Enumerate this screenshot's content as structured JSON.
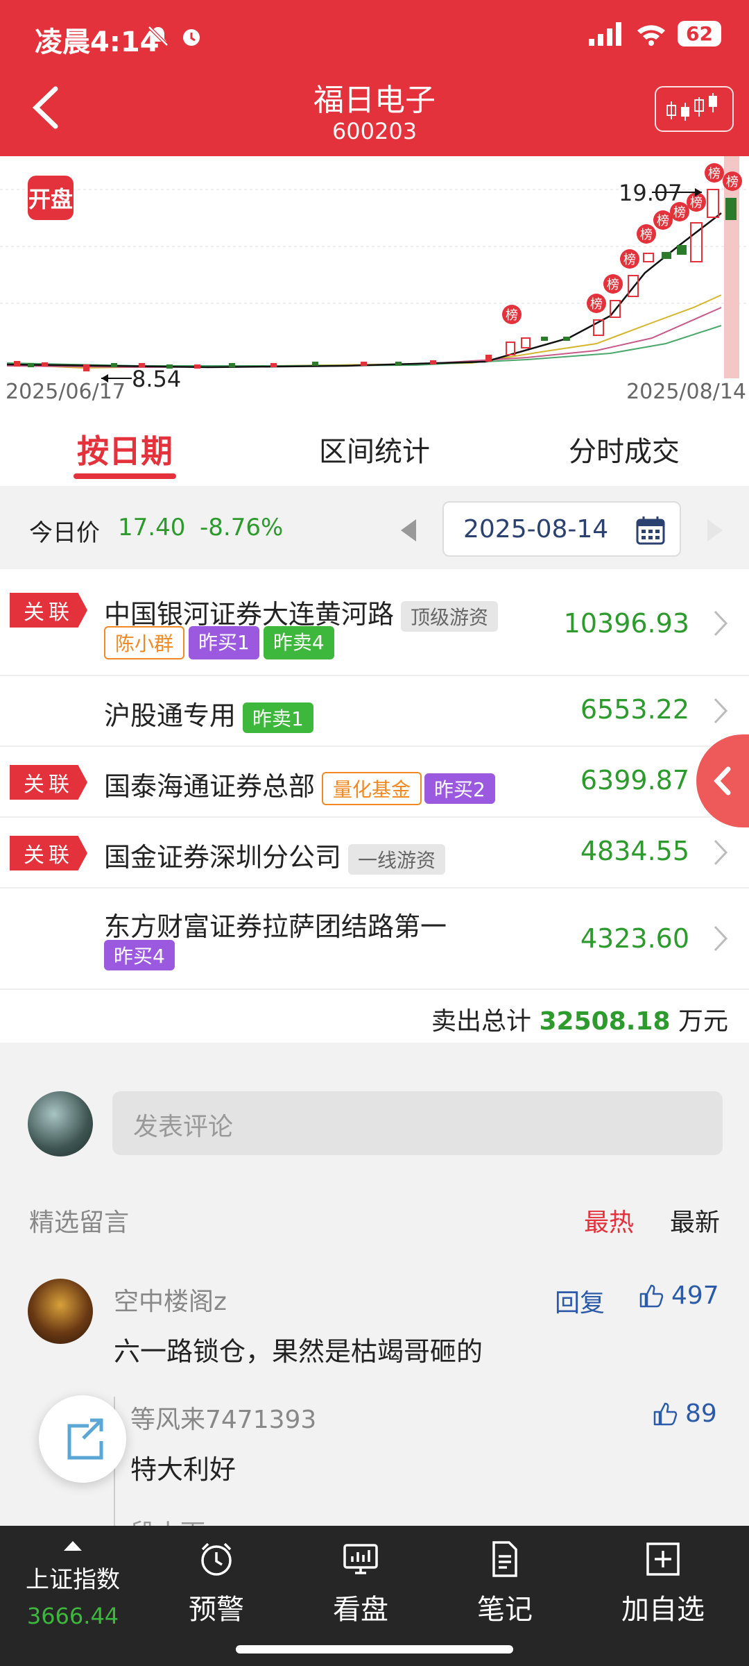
{
  "status_bar": {
    "time": "凌晨4:14",
    "battery": "62"
  },
  "header": {
    "title": "福日电子",
    "code": "600203"
  },
  "chart": {
    "badge": "开盘",
    "high_label": "19.07",
    "low_label": "8.54",
    "start_date": "2025/06/17",
    "end_date": "2025/08/14",
    "marker_text": "榜"
  },
  "tabs": [
    {
      "label": "按日期",
      "active": true
    },
    {
      "label": "区间统计",
      "active": false
    },
    {
      "label": "分时成交",
      "active": false
    }
  ],
  "price_bar": {
    "label": "今日价",
    "price": "17.40",
    "change": "-8.76%",
    "date": "2025-08-14"
  },
  "rows": [
    {
      "related": "关联",
      "name": "中国银河证券大连黄河路",
      "badge": "顶级游资",
      "sub": [
        "陈小群",
        "昨买1",
        "昨卖4"
      ],
      "amount": "10396.93"
    },
    {
      "related": "",
      "name": "沪股通专用",
      "badge": "昨卖1",
      "sub": [],
      "amount": "6553.22"
    },
    {
      "related": "关联",
      "name": "国泰海通证券总部",
      "badge": "量化基金",
      "badge2": "昨买2",
      "sub": [],
      "amount": "6399.87"
    },
    {
      "related": "关联",
      "name": "国金证券深圳分公司",
      "badge": "一线游资",
      "sub": [],
      "amount": "4834.55"
    },
    {
      "related": "",
      "name": "东方财富证券拉萨团结路第一",
      "badge": "",
      "sub": [
        "昨买4"
      ],
      "amount": "4323.60"
    }
  ],
  "total": {
    "label": "卖出总计",
    "value": "32508.18",
    "unit": "万元"
  },
  "comments": {
    "placeholder": "发表评论",
    "section_title": "精选留言",
    "sort_hot": "最热",
    "sort_new": "最新",
    "items": [
      {
        "user": "空中楼阁z",
        "reply_label": "回复",
        "likes": "497",
        "text": "六一路锁仓，果然是枯竭哥砸的"
      }
    ],
    "replies": [
      {
        "user": "等风来7471393",
        "likes": "89",
        "text": "特大利好"
      },
      {
        "user": "段小雨",
        "likes": ""
      }
    ]
  },
  "bottom_nav": {
    "index_label": "上证指数",
    "index_value": "3666.44",
    "items": [
      {
        "label": "预警",
        "icon": "alarm-clock-icon"
      },
      {
        "label": "看盘",
        "icon": "monitor-chart-icon"
      },
      {
        "label": "笔记",
        "icon": "note-icon"
      },
      {
        "label": "加自选",
        "icon": "add-square-icon"
      }
    ]
  },
  "colors": {
    "brand_red": "#e3323b",
    "gain_green": "#2c9a2c",
    "link_blue": "#2b5aa8"
  }
}
